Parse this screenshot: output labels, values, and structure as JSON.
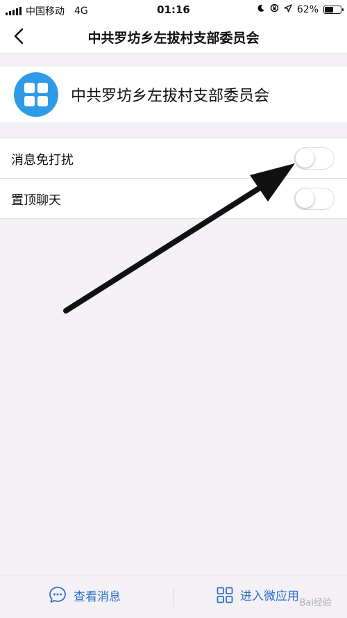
{
  "status_bar": {
    "carrier": "中国移动",
    "network": "4G",
    "time": "01:16",
    "battery": "62%",
    "battery_level": 0.62
  },
  "nav": {
    "title": "中共罗坊乡左拔村支部委员会"
  },
  "group": {
    "name": "中共罗坊乡左拔村支部委员会",
    "avatar_color": "#2f9be6"
  },
  "settings": [
    {
      "label": "消息免打扰",
      "enabled": false
    },
    {
      "label": "置顶聊天",
      "enabled": false
    }
  ],
  "bottom_bar": {
    "messages_label": "查看消息",
    "enter_label": "进入微应用"
  },
  "watermark": "Bai经验",
  "colors": {
    "accent": "#2a6fc9",
    "background": "#f4f1f6"
  }
}
